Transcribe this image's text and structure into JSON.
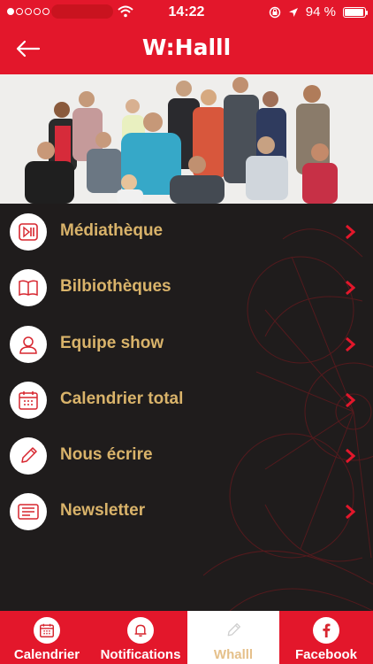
{
  "status_bar": {
    "time": "14:22",
    "battery": "94 %",
    "battery_level": 0.94,
    "signal_dots": 5,
    "signal_filled": 1
  },
  "header": {
    "logo": "W:Halll"
  },
  "menu": {
    "items": [
      {
        "label": "Médiathèque",
        "icon": "play-pause-icon"
      },
      {
        "label": "Bilbiothèques",
        "icon": "book-icon"
      },
      {
        "label": "Equipe show",
        "icon": "person-icon"
      },
      {
        "label": "Calendrier total",
        "icon": "calendar-icon"
      },
      {
        "label": "Nous écrire",
        "icon": "pencil-icon"
      },
      {
        "label": "Newsletter",
        "icon": "newspaper-icon"
      }
    ]
  },
  "tabbar": {
    "tabs": [
      {
        "label": "Calendrier",
        "icon": "calendar-icon"
      },
      {
        "label": "Notifications",
        "icon": "bell-icon"
      },
      {
        "label": "Whalll",
        "icon": "pencil-icon",
        "active": true
      },
      {
        "label": "Facebook",
        "icon": "facebook-icon"
      }
    ]
  },
  "colors": {
    "brand_red": "#e3172b",
    "menu_text": "#d9b36a",
    "menu_bg": "#1f1c1c",
    "active_tab_text": "#e5c08a"
  }
}
